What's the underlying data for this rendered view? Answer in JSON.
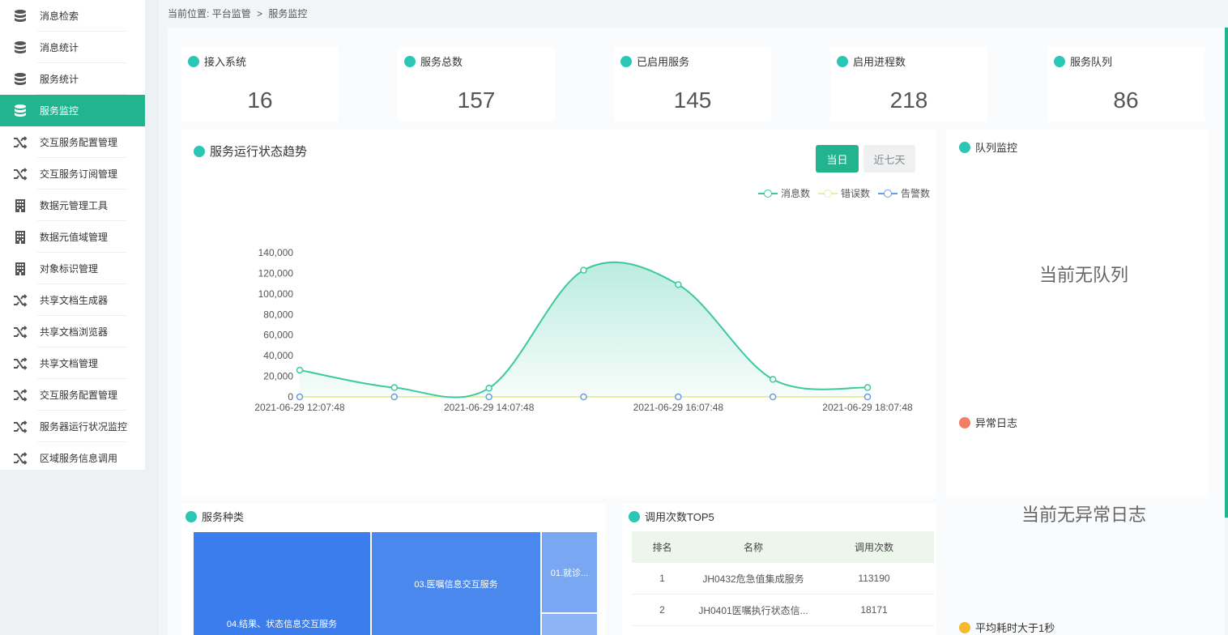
{
  "sidebar": {
    "items": [
      {
        "label": "消息检索",
        "icon": "database-icon",
        "active": false
      },
      {
        "label": "消息统计",
        "icon": "database-icon",
        "active": false
      },
      {
        "label": "服务统计",
        "icon": "database-icon",
        "active": false
      },
      {
        "label": "服务监控",
        "icon": "database-icon",
        "active": true
      },
      {
        "label": "交互服务配置管理",
        "icon": "shuffle-icon",
        "active": false
      },
      {
        "label": "交互服务订阅管理",
        "icon": "shuffle-icon",
        "active": false
      },
      {
        "label": "数据元管理工具",
        "icon": "building-icon",
        "active": false
      },
      {
        "label": "数据元值域管理",
        "icon": "building-icon",
        "active": false
      },
      {
        "label": "对象标识管理",
        "icon": "building-icon",
        "active": false
      },
      {
        "label": "共享文档生成器",
        "icon": "shuffle-icon",
        "active": false
      },
      {
        "label": "共享文档浏览器",
        "icon": "shuffle-icon",
        "active": false
      },
      {
        "label": "共享文档管理",
        "icon": "shuffle-icon",
        "active": false
      },
      {
        "label": "交互服务配置管理",
        "icon": "shuffle-icon",
        "active": false
      },
      {
        "label": "服务器运行状况监控",
        "icon": "shuffle-icon",
        "active": false
      },
      {
        "label": "区域服务信息调用",
        "icon": "shuffle-icon",
        "active": false
      }
    ]
  },
  "breadcrumb": {
    "prefix": "当前位置:",
    "level1": "平台监管",
    "separator": ">",
    "level2": "服务监控"
  },
  "stats": [
    {
      "title": "接入系统",
      "value": "16"
    },
    {
      "title": "服务总数",
      "value": "157"
    },
    {
      "title": "已启用服务",
      "value": "145"
    },
    {
      "title": "启用进程数",
      "value": "218"
    },
    {
      "title": "服务队列",
      "value": "86"
    }
  ],
  "trend": {
    "title": "服务运行状态趋势",
    "btn_today": "当日",
    "btn_week": "近七天",
    "legend": [
      {
        "name": "消息数",
        "color": "#3cc9a0"
      },
      {
        "name": "错误数",
        "color": "#e6f0a8"
      },
      {
        "name": "告警数",
        "color": "#6b9ee0"
      }
    ]
  },
  "chart_data": {
    "type": "line",
    "x": [
      "2021-06-29 12:07:48",
      "2021-06-29 13:07:48",
      "2021-06-29 14:07:48",
      "2021-06-29 15:07:48",
      "2021-06-29 16:07:48",
      "2021-06-29 17:07:48",
      "2021-06-29 18:07:48"
    ],
    "x_tick_labels": [
      "2021-06-29 12:07:48",
      "2021-06-29 14:07:48",
      "2021-06-29 16:07:48",
      "2021-06-29 18:07:48"
    ],
    "y_ticks": [
      "0",
      "20,000",
      "40,000",
      "60,000",
      "80,000",
      "100,000",
      "120,000",
      "140,000"
    ],
    "ylim": [
      0,
      140000
    ],
    "series": [
      {
        "name": "消息数",
        "values": [
          26000,
          9000,
          8500,
          123000,
          109000,
          17000,
          9000
        ],
        "color": "#3cc9a0",
        "area": true
      },
      {
        "name": "错误数",
        "values": [
          0,
          0,
          0,
          0,
          0,
          0,
          0
        ],
        "color": "#e6f0a8"
      },
      {
        "name": "告警数",
        "values": [
          0,
          0,
          0,
          0,
          0,
          0,
          0
        ],
        "color": "#6b9ee0"
      }
    ]
  },
  "queue": {
    "title": "队列监控",
    "empty": "当前无队列"
  },
  "errors": {
    "title": "异常日志",
    "empty": "当前无异常日志"
  },
  "avg": {
    "title": "平均耗时大于1秒"
  },
  "service_types": {
    "title": "服务种类",
    "blocks": [
      {
        "label": "04.结果、状态信息交互服务",
        "color": "#3b7ded"
      },
      {
        "label": "03.医嘱信息交互服务",
        "color": "#4a88ee"
      },
      {
        "label": "01.就诊...",
        "color": "#7aa7f2"
      },
      {
        "label": "",
        "color": "#8db4f4"
      }
    ]
  },
  "top5": {
    "title": "调用次数TOP5",
    "headers": [
      "排名",
      "名称",
      "调用次数"
    ],
    "rows": [
      {
        "rank": "1",
        "name": "JH0432危急值集成服务",
        "count": "113190"
      },
      {
        "rank": "2",
        "name": "JH0401医嘱执行状态信...",
        "count": "18171"
      }
    ]
  }
}
